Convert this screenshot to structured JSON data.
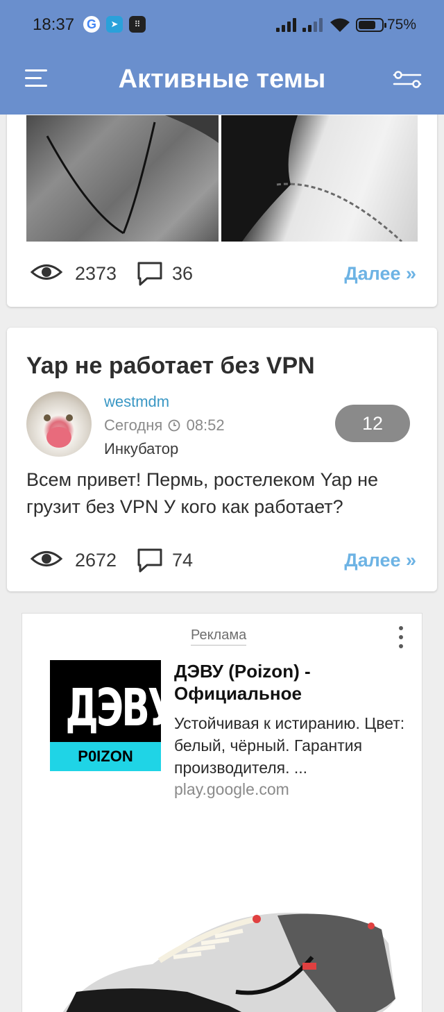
{
  "status_bar": {
    "time": "18:37",
    "battery": "75%",
    "battery_level": 0.75,
    "app_icons": [
      "google-icon",
      "telegram-icon",
      "app-grid-icon"
    ]
  },
  "app_bar": {
    "title": "Активные темы",
    "menu_icon": "hamburger-menu-icon",
    "filter_icon": "filter-sliders-icon"
  },
  "feed": {
    "card_prev": {
      "views": "2373",
      "comments": "36",
      "more": "Далее »"
    },
    "card_topic": {
      "title": "Yap не работает без VPN",
      "author": "westmdm",
      "date": "Сегодня",
      "time": "08:52",
      "forum": "Инкубатор",
      "replies_badge": "12",
      "excerpt": "Всем привет! Пермь, ростелеком Yap не грузит без VPN У кого как работает?",
      "views": "2672",
      "comments": "74",
      "more": "Далее »"
    }
  },
  "ad": {
    "label": "Реклама",
    "logo_text": "ДЭВУ",
    "logo_sub": "P0IZON",
    "title": "ДЭВУ (Poizon) - Официальное",
    "description": "Устойчивая к истиранию. Цвет: белый, чёрный. Гарантия производителя. ...",
    "domain": "play.google.com"
  },
  "colors": {
    "header": "#6a8fcd",
    "link": "#6db3e4",
    "author": "#3a97c4",
    "badge": "#8a8a8a"
  }
}
